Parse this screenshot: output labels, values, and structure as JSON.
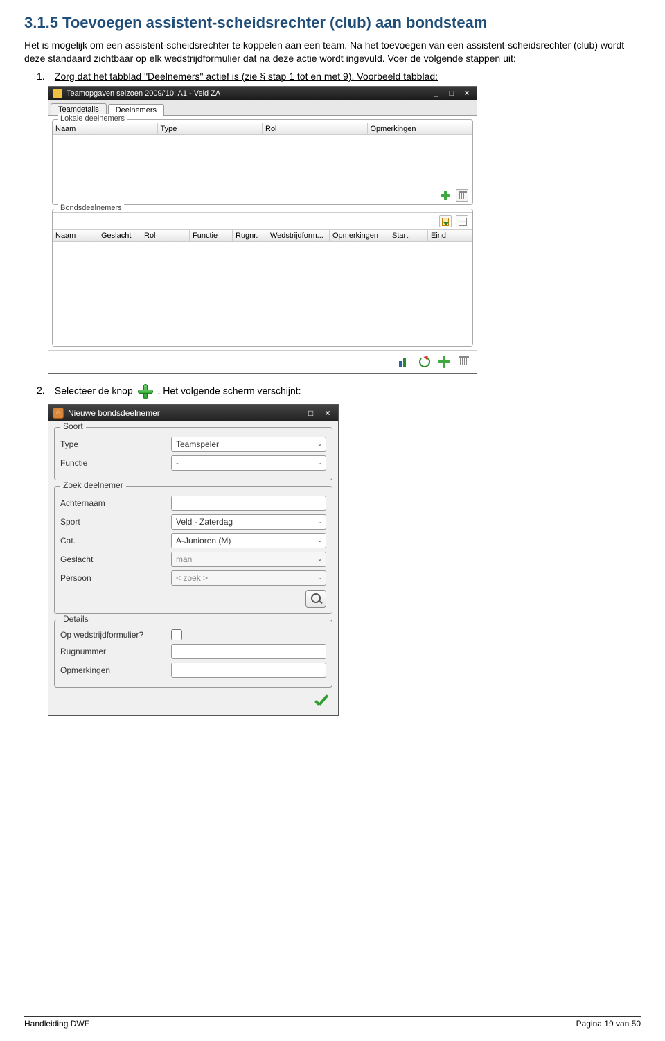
{
  "heading": "3.1.5 Toevoegen assistent-scheidsrechter (club) aan bondsteam",
  "intro1": "Het is mogelijk om een assistent-scheidsrechter te koppelen aan een team. Na het toevoegen van een assistent-scheidsrechter (club) wordt deze standaard zichtbaar op elk wedstrijdformulier dat na deze actie wordt ingevuld. Voer de volgende stappen uit:",
  "step1_a": "Zorg dat het tabblad \"Deelnemers\" actief is (zie §",
  "step1_b": " stap 1 tot en met 9). Voorbeeld tabblad:",
  "step2_a": "Selecteer de knop ",
  "step2_b": ". Het volgende scherm verschijnt:",
  "win1": {
    "title": "Teamopgaven seizoen 2009/'10: A1 - Veld ZA",
    "tabs": [
      "Teamdetails",
      "Deelnemers"
    ],
    "group_lokale": "Lokale deelnemers",
    "lokale_cols": [
      "Naam",
      "Type",
      "Rol",
      "Opmerkingen"
    ],
    "group_bonds": "Bondsdeelnemers",
    "bonds_cols": [
      "Naam",
      "Geslacht",
      "Rol",
      "Functie",
      "Rugnr.",
      "Wedstrijdform...",
      "Opmerkingen",
      "Start",
      "Eind"
    ]
  },
  "win2": {
    "title": "Nieuwe bondsdeelnemer",
    "group_soort": "Soort",
    "lbl_type": "Type",
    "val_type": "Teamspeler",
    "lbl_functie": "Functie",
    "val_functie": "-",
    "group_zoek": "Zoek deelnemer",
    "lbl_achternaam": "Achternaam",
    "lbl_sport": "Sport",
    "val_sport": "Veld - Zaterdag",
    "lbl_cat": "Cat.",
    "val_cat": "A-Junioren (M)",
    "lbl_geslacht": "Geslacht",
    "val_geslacht": "man",
    "lbl_persoon": "Persoon",
    "val_persoon": "< zoek >",
    "group_details": "Details",
    "lbl_opwed": "Op wedstrijdformulier?",
    "lbl_rugnr": "Rugnummer",
    "lbl_opm": "Opmerkingen"
  },
  "footer": {
    "left": "Handleiding DWF",
    "right": "Pagina 19 van 50"
  }
}
